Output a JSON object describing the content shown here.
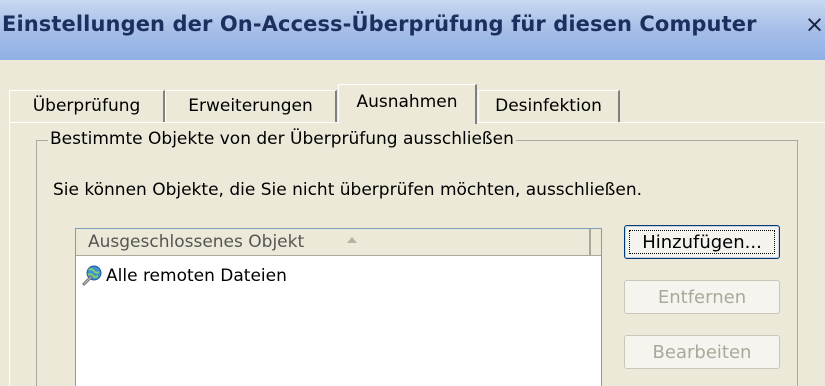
{
  "window": {
    "title": "Einstellungen der On-Access-Überprüfung für diesen Computer",
    "close_label": "×"
  },
  "tabs": [
    {
      "label": "Überprüfung",
      "active": false
    },
    {
      "label": "Erweiterungen",
      "active": false
    },
    {
      "label": "Ausnahmen",
      "active": true
    },
    {
      "label": "Desinfektion",
      "active": false
    }
  ],
  "exclusions": {
    "group_label": "Bestimmte Objekte von der Überprüfung ausschließen",
    "description": "Sie können Objekte, die Sie nicht überprüfen möchten, ausschließen.",
    "list": {
      "column_header": "Ausgeschlossenes Objekt",
      "sort": "ascending",
      "items": [
        {
          "label": "Alle remoten Dateien",
          "icon": "network-files-icon"
        }
      ]
    },
    "buttons": {
      "add": "Hinzufügen...",
      "remove": "Entfernen",
      "edit": "Bearbeiten"
    }
  },
  "colors": {
    "titlebar": "#a9c0e8",
    "title_text": "#1c2f5e",
    "dialog_bg": "#ece9d8",
    "disabled_text": "#aca899"
  }
}
